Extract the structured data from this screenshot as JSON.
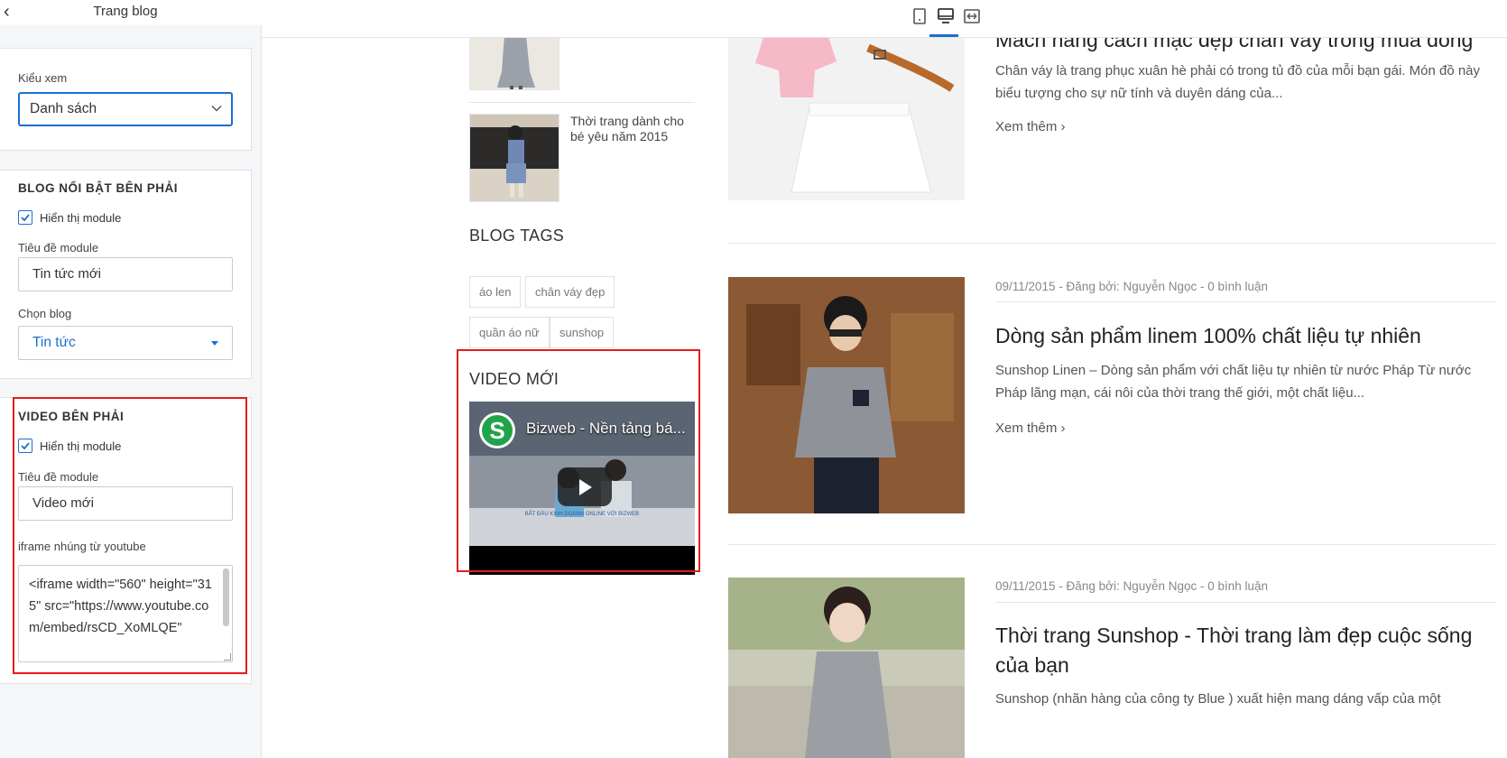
{
  "panel": {
    "title": "Trang blog",
    "view_mode": {
      "label": "Kiểu xem",
      "value": "Danh sách"
    },
    "featured_blog": {
      "heading": "BLOG NỔI BẬT BÊN PHẢI",
      "show_label": "Hiển thị module",
      "title_label": "Tiêu đề module",
      "title_value": "Tin tức mới",
      "blog_label": "Chọn blog",
      "blog_value": "Tin tức"
    },
    "video": {
      "heading": "VIDEO BÊN PHẢI",
      "show_label": "Hiển thị module",
      "title_label": "Tiêu đề module",
      "title_value": "Video mới",
      "iframe_label": "iframe nhúng từ youtube",
      "iframe_value": "<iframe width=\"560\" height=\"315\" src=\"https://www.youtube.com/embed/rsCD_XoMLQE\""
    }
  },
  "toolbar": {
    "icons": [
      "mobile-icon",
      "desktop-icon",
      "fullwidth-icon"
    ],
    "active": "desktop-icon",
    "accent": "#1b6fd0"
  },
  "preview": {
    "sidebar_post_title": "Thời trang dành cho bé yêu năm 2015",
    "tags_title": "BLOG TAGS",
    "tags": [
      "áo len",
      "chân váy đẹp",
      "quần áo nữ",
      "sunshop"
    ],
    "video_section_title": "VIDEO MỚI",
    "video_title": "Bizweb - Nền tảng bá...",
    "video_logo": "S",
    "video_caption": "BẮT ĐẦU KINH DOANH ONLINE VỚI BIZWEB",
    "posts": [
      {
        "title": "Mách nàng cách mặc đẹp chân váy trong mùa đông",
        "desc": "Chân váy là trang phục xuân hè phải có trong tủ đồ của mỗi bạn gái. Món đồ này biểu tượng cho sự nữ tính và duyên dáng của...",
        "read_more": "Xem thêm ›"
      },
      {
        "meta": "09/11/2015 - Đăng bởi: Nguyễn Ngọc - 0 bình luận",
        "title": "Dòng sản phẩm linem 100% chất liệu tự nhiên",
        "desc": "Sunshop Linen – Dòng sản phẩm với chất liệu tự nhiên từ nước Pháp Từ nước Pháp lãng mạn, cái nôi của thời trang thế giới, một chất liệu...",
        "read_more": "Xem thêm ›"
      },
      {
        "meta": "09/11/2015 - Đăng bởi: Nguyễn Ngọc - 0 bình luận",
        "title": "Thời trang Sunshop - Thời trang làm đẹp cuộc sống của bạn",
        "desc": "Sunshop (nhãn hàng của công ty Blue ) xuất hiện mang dáng vấp của một"
      }
    ]
  },
  "colors": {
    "highlight_red": "#e31d1d",
    "accent_blue": "#1b6fd0"
  }
}
